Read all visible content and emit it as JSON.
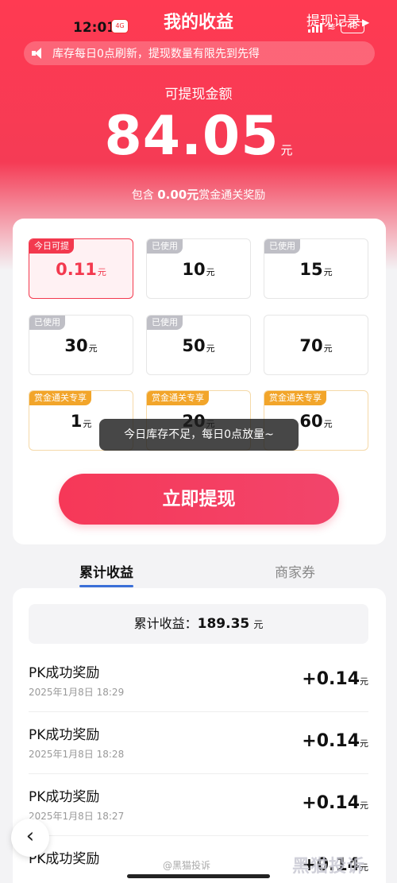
{
  "status": {
    "time": "12:01",
    "signal_label": "4G",
    "battery": "48"
  },
  "header": {
    "title": "我的收益",
    "history_link": "提现记录"
  },
  "notice": {
    "text": "库存每日0点刷新，提现数量有限先到先得"
  },
  "balance": {
    "label": "可提现金额",
    "value": "84.05",
    "unit": "元",
    "bounty_prefix": "包含",
    "bounty_amount": "0.00元",
    "bounty_suffix": "赏金通关奖励"
  },
  "options": [
    {
      "tag": "今日可提",
      "value": "0.11",
      "unit": "元",
      "state": "selected"
    },
    {
      "tag": "已使用",
      "value": "10",
      "unit": "元",
      "state": "used"
    },
    {
      "tag": "已使用",
      "value": "15",
      "unit": "元",
      "state": "used"
    },
    {
      "tag": "已使用",
      "value": "30",
      "unit": "元",
      "state": "used"
    },
    {
      "tag": "已使用",
      "value": "50",
      "unit": "元",
      "state": "used"
    },
    {
      "tag": "",
      "value": "70",
      "unit": "元",
      "state": "normal"
    },
    {
      "tag": "赏金通关专享",
      "value": "1",
      "unit": "元",
      "state": "bounty"
    },
    {
      "tag": "赏金通关专享",
      "value": "20",
      "unit": "元",
      "state": "bounty"
    },
    {
      "tag": "赏金通关专享",
      "value": "60",
      "unit": "元",
      "state": "bounty"
    }
  ],
  "toast": "今日库存不足，每日0点放量~",
  "withdraw_button": "立即提现",
  "tabs": [
    {
      "label": "累计收益",
      "active": true
    },
    {
      "label": "商家券",
      "active": false
    }
  ],
  "summary": {
    "label": "累计收益：",
    "value": "189.35",
    "unit": "元"
  },
  "records": [
    {
      "name": "PK成功奖励",
      "time": "2025年1月8日 18:29",
      "amount": "+0.14",
      "unit": "元"
    },
    {
      "name": "PK成功奖励",
      "time": "2025年1月8日 18:28",
      "amount": "+0.14",
      "unit": "元"
    },
    {
      "name": "PK成功奖励",
      "time": "2025年1月8日 18:27",
      "amount": "+0.14",
      "unit": "元"
    },
    {
      "name": "PK成功奖励",
      "time": "",
      "amount": "+0.14",
      "unit": "元"
    }
  ],
  "watermark": "@黑猫投诉",
  "brand_watermark": "黑猫投诉",
  "colors": {
    "primary": "#f3394e",
    "bounty": "#f2a52a",
    "tab_indicator": "#3a6fd8"
  },
  "icons": {
    "speaker": "speaker-icon",
    "back": "chevron-left-icon"
  }
}
